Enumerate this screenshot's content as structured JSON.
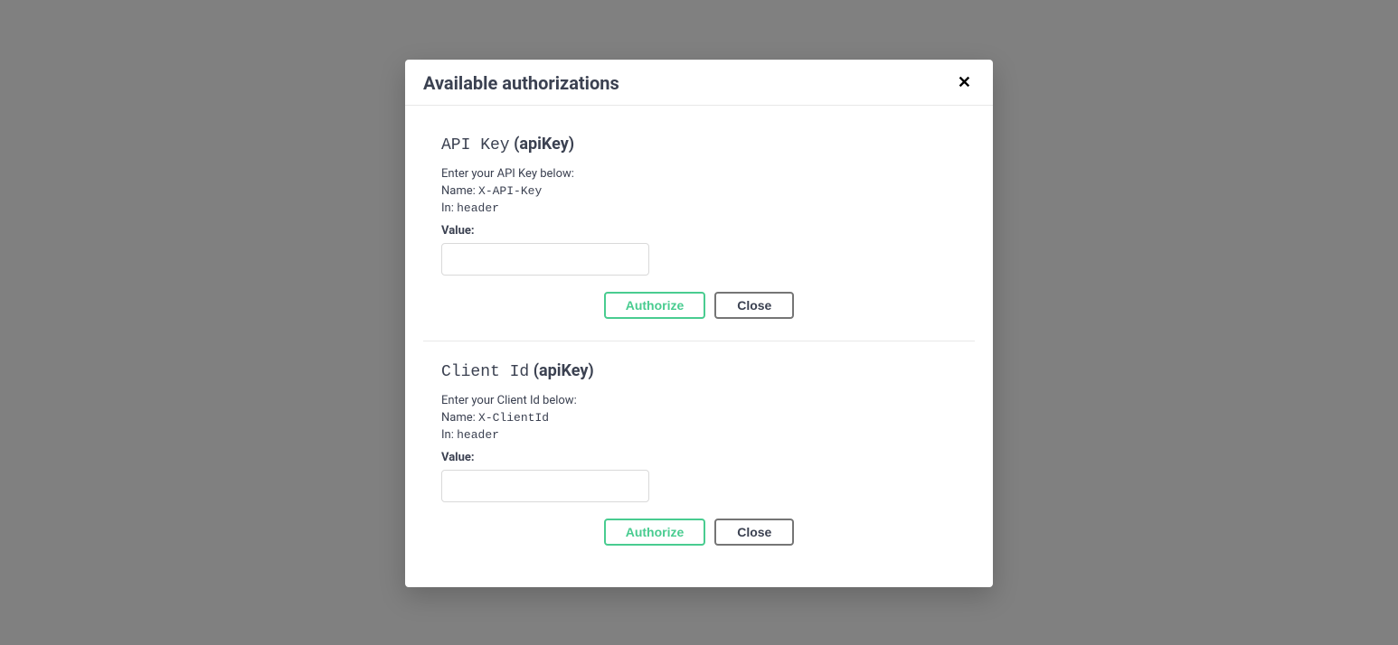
{
  "modal": {
    "title": "Available authorizations",
    "sections": [
      {
        "title_name": "API Key",
        "title_scheme": "(apiKey)",
        "description": "Enter your API Key below:",
        "name_label": "Name:",
        "name_value": "X-API-Key",
        "in_label": "In:",
        "in_value": "header",
        "value_label": "Value:",
        "value": "",
        "authorize_label": "Authorize",
        "close_label": "Close"
      },
      {
        "title_name": "Client Id",
        "title_scheme": "(apiKey)",
        "description": "Enter your Client Id below:",
        "name_label": "Name:",
        "name_value": "X-ClientId",
        "in_label": "In:",
        "in_value": "header",
        "value_label": "Value:",
        "value": "",
        "authorize_label": "Authorize",
        "close_label": "Close"
      }
    ]
  }
}
